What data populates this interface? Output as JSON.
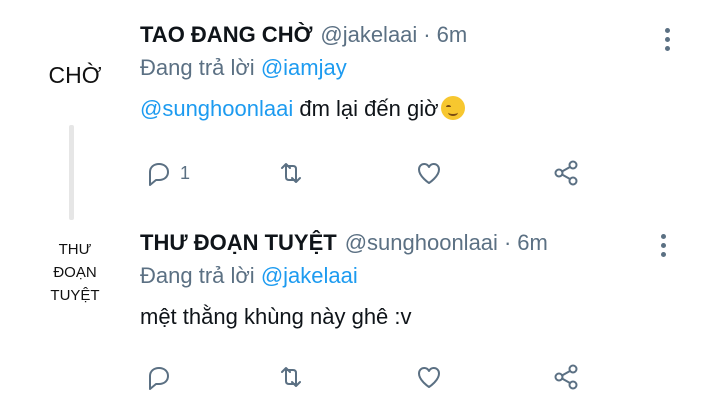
{
  "tweets": [
    {
      "avatar_text": "CHỜ",
      "name": "TAO ĐANG CHỜ",
      "handle": "@jakelaai",
      "separator": "·",
      "time": "6m",
      "reply_prefix": "Đang trả lời",
      "reply_to": "@iamjay",
      "mention": "@sunghoonlaai",
      "text": " đm lại đến giờ",
      "emoji_icon": "smiling-face-icon",
      "reply_count": "1"
    },
    {
      "avatar_lines": [
        "THƯ",
        "ĐOẠN",
        "TUYỆT"
      ],
      "name": "THƯ ĐOẠN TUYỆT",
      "handle": "@sunghoonlaai",
      "separator": "·",
      "time": "6m",
      "reply_prefix": "Đang trả lời",
      "reply_to": "@jakelaai",
      "text": "mệt thằng khùng này ghê :v",
      "reply_count": ""
    }
  ],
  "icons": {
    "reply": "reply-icon",
    "retweet": "retweet-icon",
    "like": "heart-icon",
    "share": "share-icon",
    "more": "more-vertical-icon"
  },
  "colors": {
    "link": "#1d9bf0",
    "muted": "#5b7083",
    "text": "#0f1419"
  }
}
